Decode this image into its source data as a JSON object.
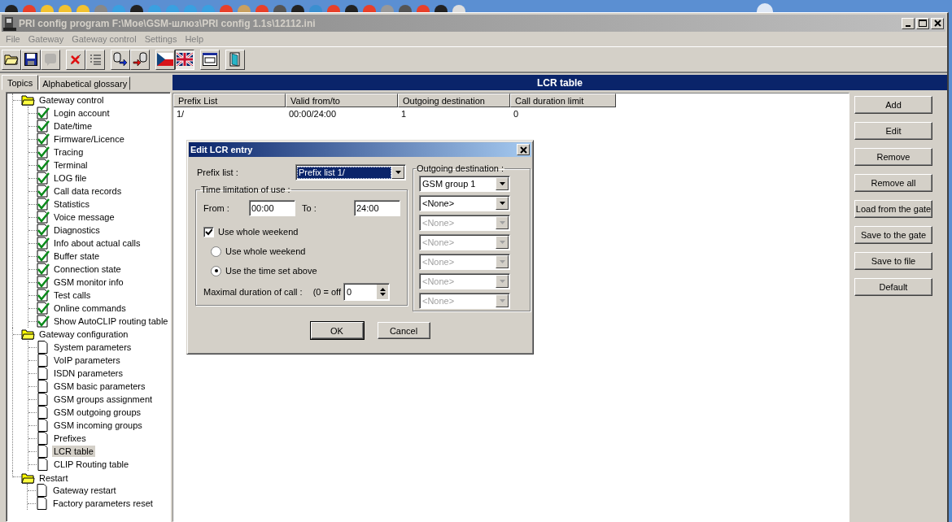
{
  "window": {
    "title": "PRI config program F:\\Moe\\GSM-шлюз\\PRI config 1.1s\\12112.ini"
  },
  "menu": [
    "File",
    "Gateway",
    "Gateway control",
    "Settings",
    "Help"
  ],
  "toolbar": [
    {
      "buttons": [
        {
          "kind": "open",
          "disabled": false,
          "selected": false
        },
        {
          "kind": "save",
          "disabled": false,
          "selected": false
        },
        {
          "kind": "comment",
          "disabled": true,
          "selected": false
        }
      ]
    },
    {
      "buttons": [
        {
          "kind": "delete",
          "disabled": false,
          "selected": false
        },
        {
          "kind": "list",
          "disabled": false,
          "selected": false
        }
      ]
    },
    {
      "buttons": [
        {
          "kind": "export",
          "disabled": false,
          "selected": false
        },
        {
          "kind": "import",
          "disabled": false,
          "selected": false
        }
      ]
    },
    {
      "buttons": [
        {
          "kind": "czech",
          "disabled": false,
          "selected": false
        },
        {
          "kind": "british",
          "disabled": false,
          "selected": true
        }
      ]
    },
    {
      "buttons": [
        {
          "kind": "terminal",
          "disabled": false,
          "selected": false
        }
      ]
    },
    {
      "buttons": [
        {
          "kind": "exit",
          "disabled": false,
          "selected": false
        }
      ]
    }
  ],
  "left_tabs": [
    {
      "label": "Topics",
      "selected": true
    },
    {
      "label": "Alphabetical glossary",
      "selected": false
    }
  ],
  "tree": [
    {
      "label": "Gateway control",
      "kind": "folder",
      "selected": false,
      "children": [
        {
          "label": "Login account",
          "kind": "check",
          "selected": false
        },
        {
          "label": "Date/time",
          "kind": "check",
          "selected": false
        },
        {
          "label": "Firmware/Licence",
          "kind": "check",
          "selected": false
        },
        {
          "label": "Tracing",
          "kind": "check",
          "selected": false
        },
        {
          "label": "Terminal",
          "kind": "check",
          "selected": false
        },
        {
          "label": "LOG file",
          "kind": "check",
          "selected": false
        },
        {
          "label": "Call data records",
          "kind": "check",
          "selected": false
        },
        {
          "label": "Statistics",
          "kind": "check",
          "selected": false
        },
        {
          "label": "Voice message",
          "kind": "check",
          "selected": false
        },
        {
          "label": "Diagnostics",
          "kind": "check",
          "selected": false
        },
        {
          "label": "Info about actual calls",
          "kind": "check",
          "selected": false
        },
        {
          "label": "Buffer state",
          "kind": "check",
          "selected": false
        },
        {
          "label": "Connection state",
          "kind": "check",
          "selected": false
        },
        {
          "label": "GSM monitor info",
          "kind": "check",
          "selected": false
        },
        {
          "label": "Test calls",
          "kind": "check",
          "selected": false
        },
        {
          "label": "Online commands",
          "kind": "check",
          "selected": false
        },
        {
          "label": "Show AutoCLIP routing table",
          "kind": "check",
          "selected": false
        }
      ]
    },
    {
      "label": "Gateway configuration",
      "kind": "folder",
      "selected": false,
      "children": [
        {
          "label": "System parameters",
          "kind": "page",
          "selected": false
        },
        {
          "label": "VoIP parameters",
          "kind": "page",
          "selected": false
        },
        {
          "label": "ISDN parameters",
          "kind": "page",
          "selected": false
        },
        {
          "label": "GSM basic parameters",
          "kind": "page",
          "selected": false
        },
        {
          "label": "GSM groups assignment",
          "kind": "page",
          "selected": false
        },
        {
          "label": "GSM outgoing groups",
          "kind": "page",
          "selected": false
        },
        {
          "label": "GSM incoming groups",
          "kind": "page",
          "selected": false
        },
        {
          "label": "Prefixes",
          "kind": "page",
          "selected": false
        },
        {
          "label": "LCR table",
          "kind": "page",
          "selected": true
        },
        {
          "label": "CLIP Routing table",
          "kind": "page",
          "selected": false
        }
      ]
    },
    {
      "label": "Restart",
      "kind": "folder",
      "selected": false,
      "children": [
        {
          "label": "Gateway restart",
          "kind": "page",
          "selected": false
        },
        {
          "label": "Factory parameters reset",
          "kind": "page",
          "selected": false
        }
      ]
    }
  ],
  "panel": {
    "title": "LCR table"
  },
  "table": {
    "columns": [
      "Prefix List",
      "Valid from/to",
      "Outgoing destination",
      "Call duration limit"
    ],
    "rows": [
      [
        "1/",
        "00:00/24:00",
        "1",
        "0"
      ]
    ]
  },
  "side_buttons": [
    "Add",
    "Edit",
    "Remove",
    "Remove all",
    "Load from the gate",
    "Save to the gate",
    "Save to file",
    "Default"
  ],
  "dialog": {
    "title": "Edit LCR entry",
    "prefix_label": "Prefix list :",
    "prefix_value": "Prefix list 1/",
    "time_group": "Time limitation of use :",
    "from_label": "From :",
    "from_value": "00:00",
    "to_label": "To :",
    "to_value": "24:00",
    "weekend_checkbox": {
      "label": "Use whole weekend",
      "checked": true
    },
    "radios": [
      {
        "label": "Use whole weekend",
        "selected": false
      },
      {
        "label": "Use the time set above",
        "selected": true
      }
    ],
    "duration_label": "Maximal duration of call :",
    "duration_hint": "(0 = off",
    "duration_value": "0",
    "destination_group": "Outgoing destination :",
    "destinations": [
      {
        "value": "GSM group 1",
        "disabled": false
      },
      {
        "value": "<None>",
        "disabled": false
      },
      {
        "value": "<None>",
        "disabled": true
      },
      {
        "value": "<None>",
        "disabled": true
      },
      {
        "value": "<None>",
        "disabled": true
      },
      {
        "value": "<None>",
        "disabled": true
      },
      {
        "value": "<None>",
        "disabled": true
      }
    ],
    "buttons": [
      "OK",
      "Cancel"
    ]
  }
}
